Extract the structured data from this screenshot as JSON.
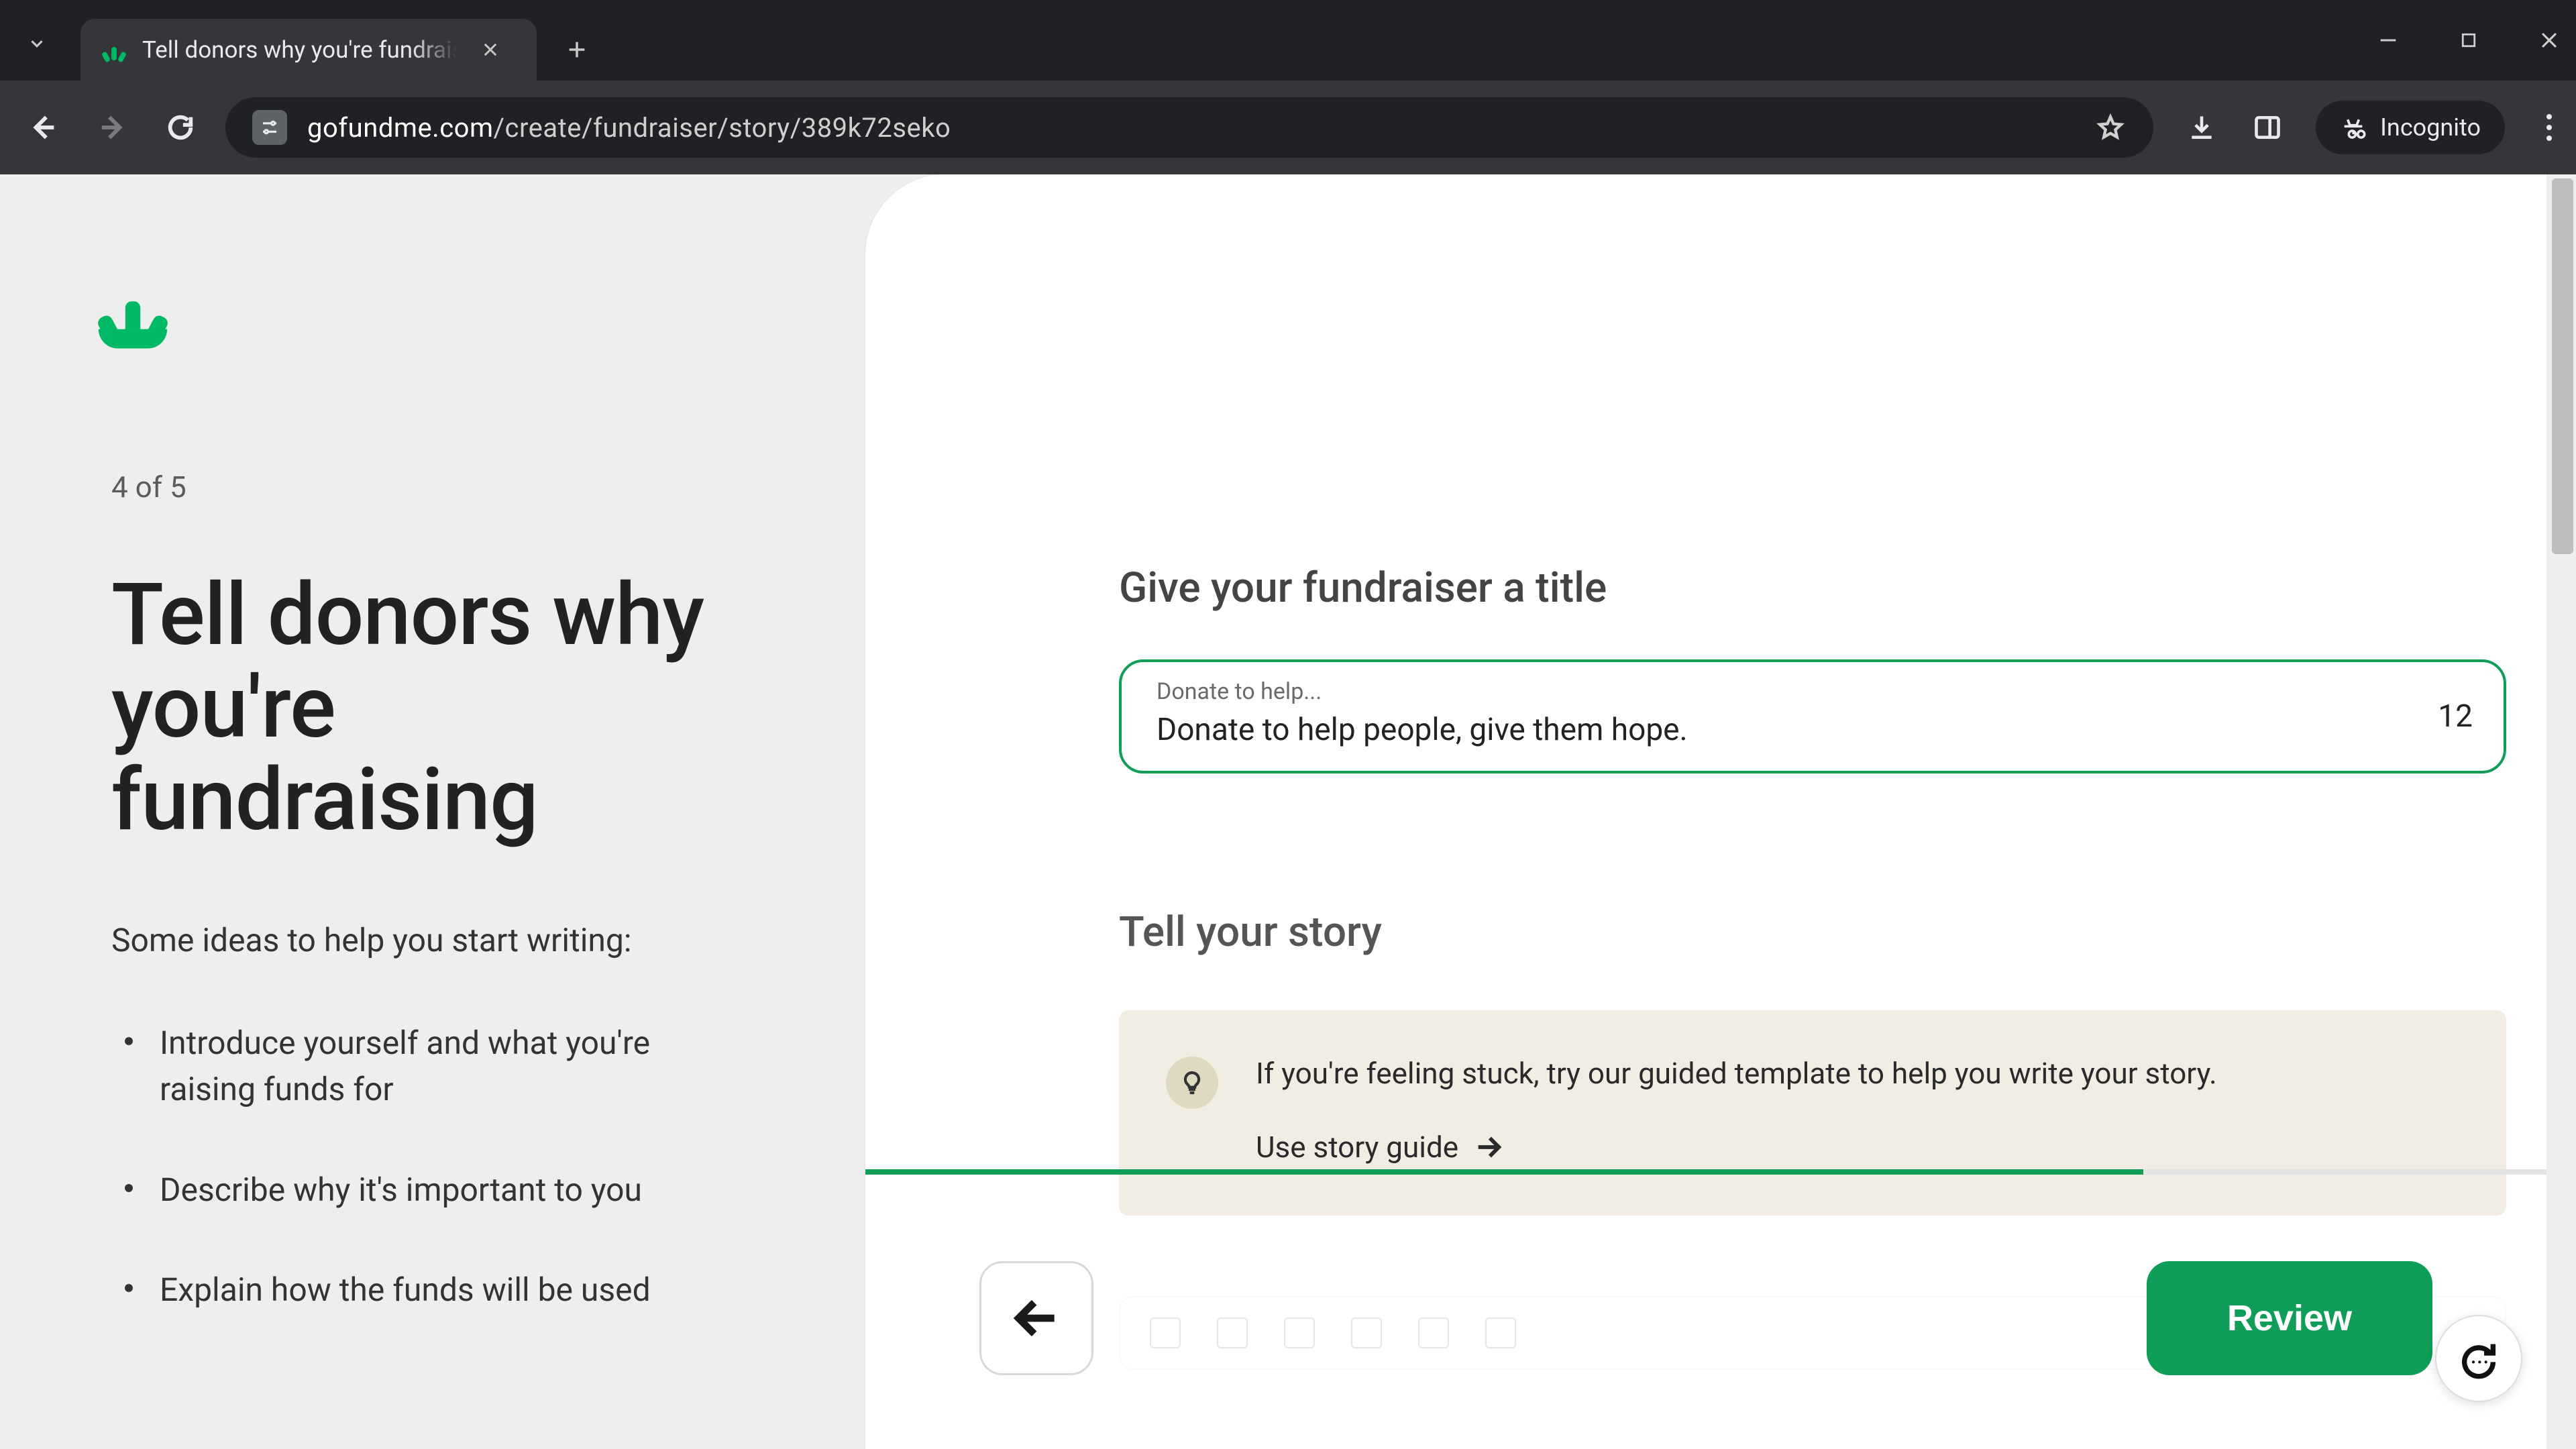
{
  "browser": {
    "tab_title": "Tell donors why you're fundrais",
    "url_host": "gofundme.com",
    "url_path": "/create/fundraiser/story/389k72seko",
    "incognito_label": "Incognito"
  },
  "left": {
    "step": "4 of 5",
    "heading": "Tell donors why you're fundraising",
    "ideas_lead": "Some ideas to help you start writing:",
    "ideas": [
      "Introduce yourself and what you're raising funds for",
      "Describe why it's important to you",
      "Explain how the funds will be used"
    ]
  },
  "form": {
    "title_section": "Give your fundraiser a title",
    "title_label": "Donate to help...",
    "title_value": "Donate to help people, give them hope.",
    "title_remaining": "12",
    "story_section": "Tell your story",
    "callout_text": "If you're feeling stuck, try our guided template to help you write your story.",
    "story_guide_link": "Use story guide"
  },
  "footer": {
    "review": "Review"
  },
  "progress": {
    "percent": 76
  },
  "colors": {
    "accent": "#0f9d58"
  }
}
